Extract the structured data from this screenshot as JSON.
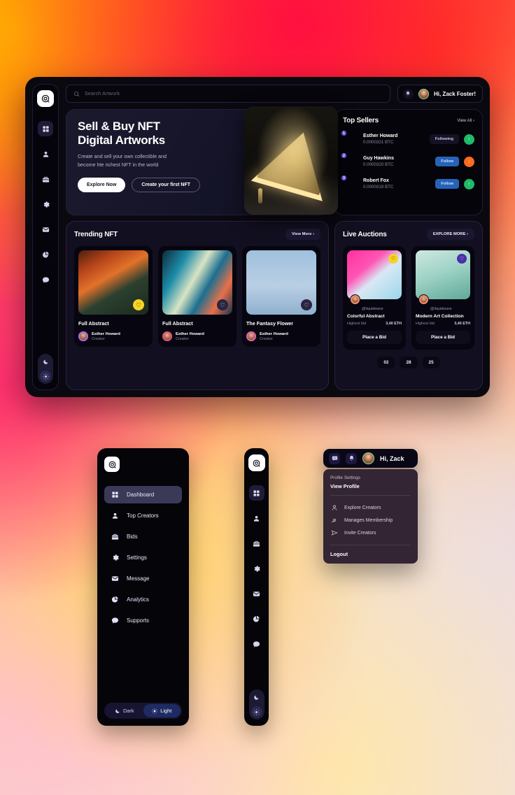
{
  "brand": {
    "logo_icon": "app-logo-icon"
  },
  "colors": {
    "accent_purple": "#6b4ad4",
    "accent_blue": "#2563b8",
    "green": "#1fba6a",
    "orange": "#ff6a1f",
    "yellow": "#f5d423",
    "panel_bg": "#120f20",
    "window_bg": "#0b0910"
  },
  "topbar": {
    "search_placeholder": "Search Artwork",
    "search_value": "",
    "search_icon": "search-icon",
    "bell_icon": "bell-icon",
    "greeting": "Hi, Zack Foster!"
  },
  "rail": {
    "items": [
      {
        "icon": "grid-icon",
        "label": "Dashboard",
        "active": true
      },
      {
        "icon": "user-icon",
        "label": "Top Creators",
        "active": false
      },
      {
        "icon": "briefcase-icon",
        "label": "Bids",
        "active": false
      },
      {
        "icon": "gear-icon",
        "label": "Settings",
        "active": false
      },
      {
        "icon": "envelope-icon",
        "label": "Message",
        "active": false
      },
      {
        "icon": "pie-chart-icon",
        "label": "Analytics",
        "active": false
      },
      {
        "icon": "chat-icon",
        "label": "Supports",
        "active": false
      }
    ],
    "theme": {
      "dark_icon": "moon-icon",
      "light_icon": "sun-icon",
      "selected": "Light"
    }
  },
  "hero": {
    "title_line1": "Sell & Buy NFT",
    "title_line2": "Digital Artworks",
    "subtitle_line1": "Create and sell your own collectible and",
    "subtitle_line2": "become hte richest NFT in the world",
    "primary_button": "Explore Now",
    "secondary_button": "Create your first NFT",
    "artwork_alt": "glowing-gold-triangle-sculpture"
  },
  "top_sellers": {
    "title": "Top Sellers",
    "view_all": "View All",
    "rows": [
      {
        "rank": "1",
        "name": "Esther Howard",
        "btc": "0.0000321 BTC",
        "action": "Following",
        "action_style": "following",
        "trend": "up",
        "trend_icon": "arrow-up-icon"
      },
      {
        "rank": "2",
        "name": "Guy Hawkins",
        "btc": "0.0000320 BTC",
        "action": "Follow",
        "action_style": "follow",
        "trend": "down",
        "trend_icon": "arrow-down-icon"
      },
      {
        "rank": "3",
        "name": "Robert Fox",
        "btc": "0.0000319 BTC",
        "action": "Follow",
        "action_style": "follow",
        "trend": "up",
        "trend_icon": "arrow-up-icon"
      }
    ]
  },
  "trending": {
    "title": "Trending NFT",
    "view_more": "View More",
    "cards": [
      {
        "title": "Full Abstract",
        "creator": "Esther Howard",
        "role": "Creator",
        "liked": true,
        "heart_icon": "heart-icon",
        "art": "orange-jungle-hand"
      },
      {
        "title": "Full Abstract",
        "creator": "Esther Howard",
        "role": "Creator",
        "liked": false,
        "heart_icon": "heart-icon",
        "art": "teal-fluid-waves"
      },
      {
        "title": "The Fantasy Flower",
        "creator": "Esther Howard",
        "role": "Creator",
        "liked": false,
        "heart_icon": "heart-icon",
        "art": "floral-sculpture"
      }
    ]
  },
  "auctions": {
    "title": "Live Auctions",
    "explore_more": "EXPLORE MORE",
    "cards": [
      {
        "handle": "@liquidwave",
        "title": "Colorful Abstract",
        "bid_label": "Highest bid",
        "bid_value": "3,40 ETH",
        "button": "Place a Bid",
        "liked": true,
        "heart_icon": "heart-icon",
        "art": "pink-candy-helmet"
      },
      {
        "handle": "@liquidwave",
        "title": "Modern Art Collection",
        "bid_label": "Highest bid",
        "bid_value": "3,40 ETH",
        "button": "Place a Bid",
        "liked": false,
        "heart_icon": "heart-icon",
        "art": "green-robot-figure"
      }
    ],
    "timer": [
      "02",
      "28",
      "25"
    ]
  },
  "sidebar_expanded": {
    "items": [
      {
        "icon": "grid-icon",
        "label": "Dashboard",
        "active": true
      },
      {
        "icon": "user-icon",
        "label": "Top Creators",
        "active": false
      },
      {
        "icon": "briefcase-icon",
        "label": "Bids",
        "active": false
      },
      {
        "icon": "gear-icon",
        "label": "Settings",
        "active": false
      },
      {
        "icon": "envelope-icon",
        "label": "Message",
        "active": false
      },
      {
        "icon": "pie-chart-icon",
        "label": "Analytics",
        "active": false
      },
      {
        "icon": "chat-icon",
        "label": "Supports",
        "active": false
      }
    ],
    "theme": {
      "dark_label": "Dark",
      "light_label": "Light",
      "selected": "Light"
    }
  },
  "profile_menu": {
    "bar": {
      "chat_icon": "chat-bubble-icon",
      "bell_icon": "bell-icon",
      "greeting": "Hi, Zack"
    },
    "settings_label": "Profile Settings",
    "view_profile": "View Profile",
    "items": [
      {
        "icon": "person-icon",
        "label": "Explore Creators"
      },
      {
        "icon": "hand-heart-icon",
        "label": "Manages Membership"
      },
      {
        "icon": "send-icon",
        "label": "Invite Creators"
      }
    ],
    "logout": "Logout"
  }
}
